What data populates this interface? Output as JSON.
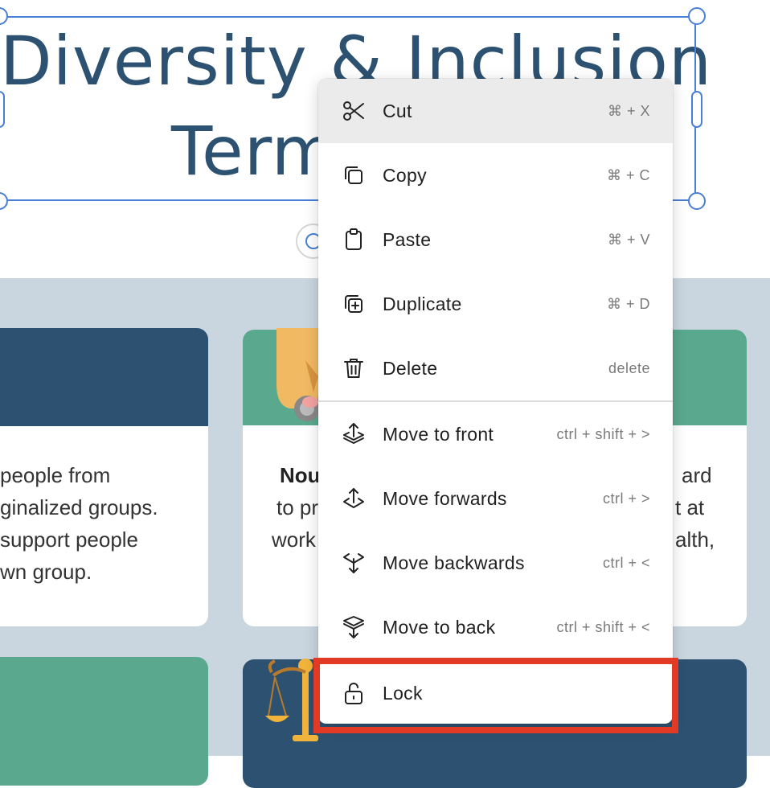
{
  "document": {
    "title_line1": "Diversity & Inclusion",
    "title_line2": "Termi",
    "cards": [
      {
        "lines": [
          "people from",
          "ginalized groups.",
          "support people",
          "wn group."
        ]
      },
      {
        "lines_bold": "Nou",
        "lines": [
          "to pr",
          "work"
        ],
        "right_lines": [
          "ard",
          "t at",
          "alth,"
        ]
      }
    ]
  },
  "colors": {
    "title": "#2d5170",
    "dark_blue": "#2d5170",
    "green": "#5aa98e",
    "panel": "#c9d5df",
    "selection": "#4a7fd6",
    "highlight": "#e23a24"
  },
  "context_menu": {
    "items": [
      {
        "label": "Cut",
        "shortcut": "⌘ + X",
        "icon": "scissors-icon"
      },
      {
        "label": "Copy",
        "shortcut": "⌘ + C",
        "icon": "copy-icon"
      },
      {
        "label": "Paste",
        "shortcut": "⌘ + V",
        "icon": "clipboard-icon"
      },
      {
        "label": "Duplicate",
        "shortcut": "⌘ + D",
        "icon": "duplicate-icon"
      },
      {
        "label": "Delete",
        "shortcut": "delete",
        "icon": "trash-icon"
      },
      {
        "label": "Move to front",
        "shortcut": "ctrl + shift + >",
        "icon": "move-to-front-icon"
      },
      {
        "label": "Move forwards",
        "shortcut": "ctrl + >",
        "icon": "move-forwards-icon"
      },
      {
        "label": "Move backwards",
        "shortcut": "ctrl + <",
        "icon": "move-backwards-icon"
      },
      {
        "label": "Move to back",
        "shortcut": "ctrl + shift + <",
        "icon": "move-to-back-icon"
      },
      {
        "label": "Lock",
        "shortcut": "",
        "icon": "unlock-icon"
      }
    ]
  }
}
